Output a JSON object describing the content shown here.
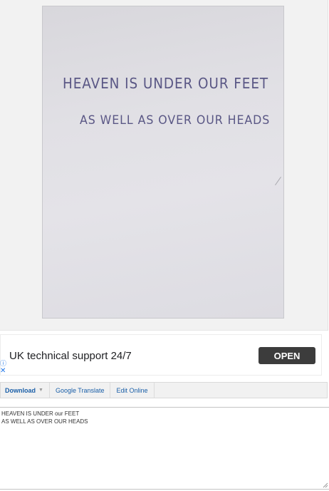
{
  "image": {
    "line1": "HEAVEN IS UNDER OUR FEET",
    "line2": "AS WELL AS OVER OUR HEADS"
  },
  "ad": {
    "text": "UK technical support 24/7",
    "button": "OPEN",
    "info_icon": "ⓘ",
    "close_icon": "✕"
  },
  "toolbar": {
    "download": "Download",
    "translate": "Google Translate",
    "edit": "Edit Online"
  },
  "result": {
    "line1": "HEAVEN IS UNDER our FEET",
    "line2": "AS WELL AS OVER OUR HEADS"
  }
}
